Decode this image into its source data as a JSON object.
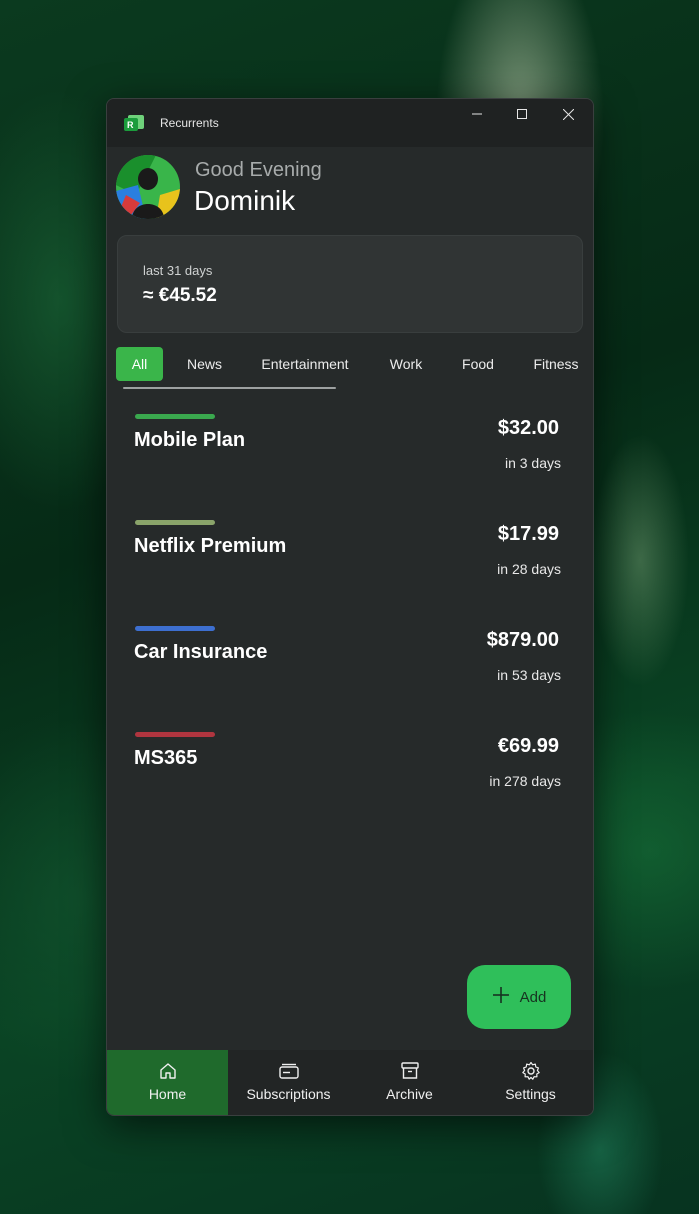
{
  "window": {
    "title": "Recurrents",
    "icon": "recurrents-app-icon",
    "controls": [
      "minimize-icon",
      "maximize-icon",
      "close-icon"
    ]
  },
  "header": {
    "greeting": "Good Evening",
    "user_name": "Dominik"
  },
  "summary": {
    "period_label": "last 31 days",
    "amount": "≈ €45.52"
  },
  "tabs": [
    {
      "label": "All",
      "active": true
    },
    {
      "label": "News"
    },
    {
      "label": "Entertainment"
    },
    {
      "label": "Work"
    },
    {
      "label": "Food"
    },
    {
      "label": "Fitness"
    }
  ],
  "subscriptions": [
    {
      "name": "Mobile Plan",
      "price": "$32.00",
      "due": "in 3 days",
      "color": "#3aa84e"
    },
    {
      "name": "Netflix Premium",
      "price": "$17.99",
      "due": "in 28 days",
      "color": "#8aa46a"
    },
    {
      "name": "Car Insurance",
      "price": "$879.00",
      "due": "in 53 days",
      "color": "#3d6fd0"
    },
    {
      "name": "MS365",
      "price": "€69.99",
      "due": "in 278 days",
      "color": "#b0353f"
    }
  ],
  "add_button": {
    "label": "Add",
    "icon": "plus-icon"
  },
  "nav": [
    {
      "label": "Home",
      "icon": "home-icon",
      "active": true
    },
    {
      "label": "Subscriptions",
      "icon": "card-icon"
    },
    {
      "label": "Archive",
      "icon": "archive-icon"
    },
    {
      "label": "Settings",
      "icon": "gear-icon"
    }
  ],
  "colors": {
    "accent": "#3ab54a",
    "fab": "#2fbf5a",
    "nav_active": "#1f6a2c",
    "window_bg": "#262a2a"
  }
}
